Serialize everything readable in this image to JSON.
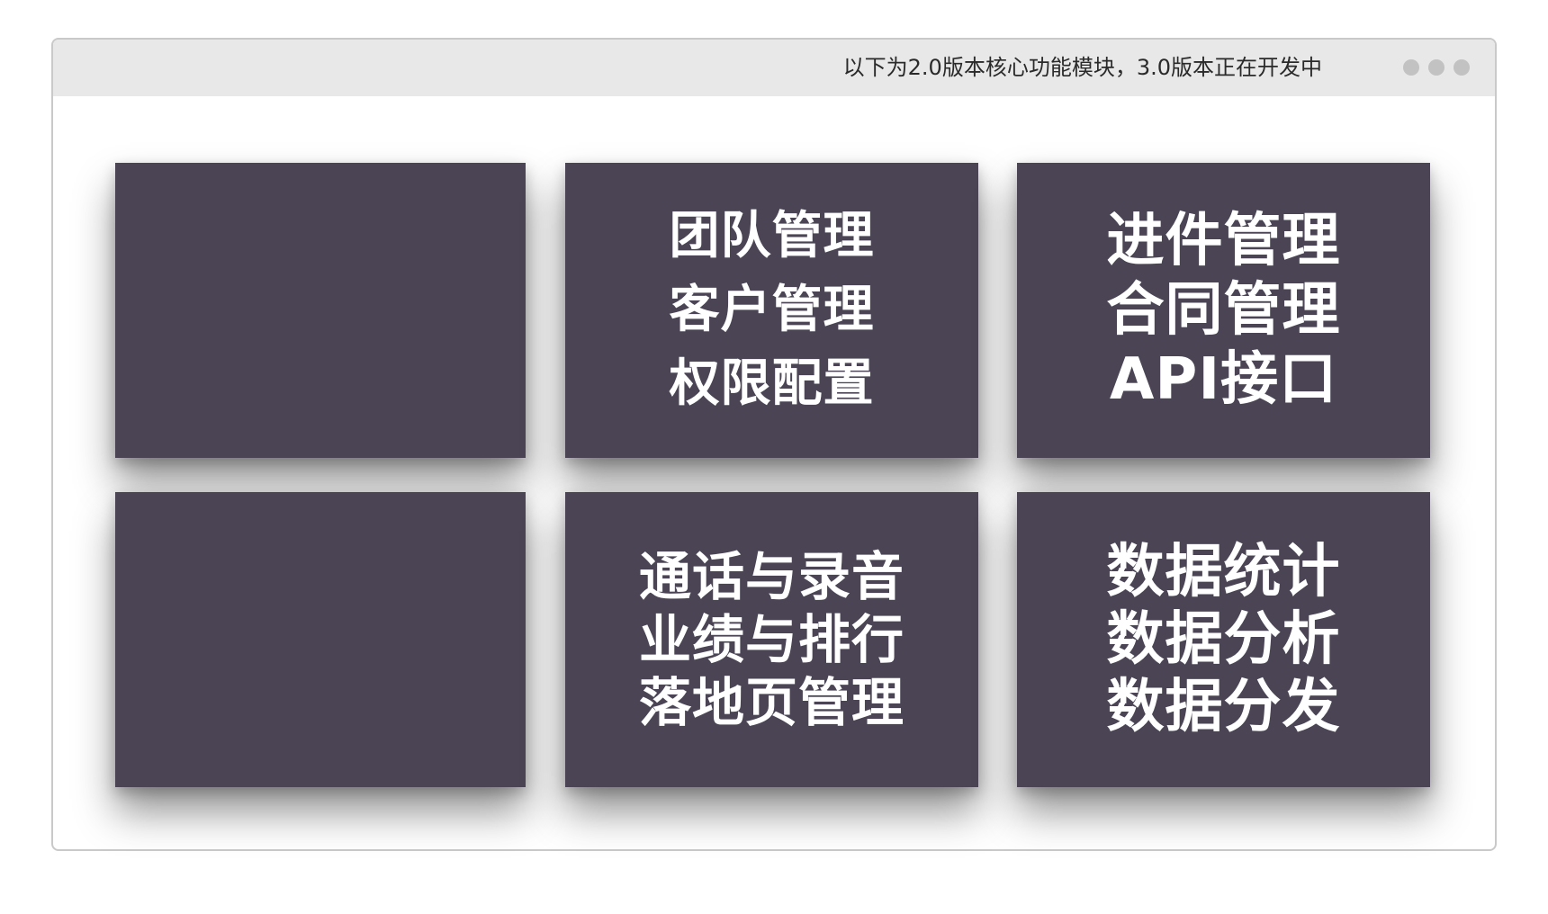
{
  "window": {
    "title": "以下为2.0版本核心功能模块，3.0版本正在开发中"
  },
  "cards": [
    {
      "lines": []
    },
    {
      "lines": [
        "团队管理",
        "客户管理",
        "权限配置"
      ]
    },
    {
      "lines": [
        "进件管理",
        "合同管理",
        "API接口"
      ]
    },
    {
      "lines": []
    },
    {
      "lines": [
        "通话与录音",
        "业绩与排行",
        "落地页管理"
      ]
    },
    {
      "lines": [
        "数据统计",
        "数据分析",
        "数据分发"
      ]
    }
  ],
  "colors": {
    "card_background": "#4a4454",
    "titlebar_background": "#e8e8e8",
    "card_text": "#ffffff"
  }
}
